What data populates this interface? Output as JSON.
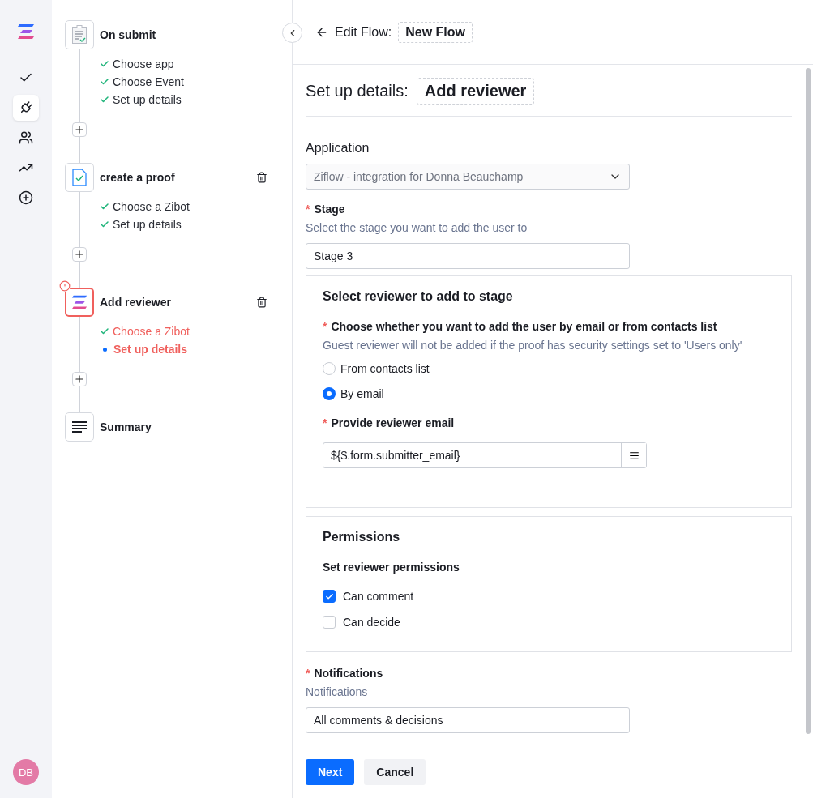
{
  "nav": {
    "items": [
      {
        "kind": "check",
        "selected": false
      },
      {
        "kind": "plug",
        "selected": true
      },
      {
        "kind": "users",
        "selected": false
      },
      {
        "kind": "trend",
        "selected": false
      },
      {
        "kind": "add",
        "selected": false
      }
    ],
    "avatar": "DB"
  },
  "steps": [
    {
      "kind": "form",
      "title": "On submit",
      "error": false,
      "deletable": false,
      "substeps": [
        {
          "label": "Choose app",
          "done": true
        },
        {
          "label": "Choose Event",
          "done": true
        },
        {
          "label": "Set up details",
          "done": true
        }
      ]
    },
    {
      "kind": "proof",
      "title": "create a proof",
      "error": false,
      "deletable": true,
      "substeps": [
        {
          "label": "Choose a Zibot",
          "done": true
        },
        {
          "label": "Set up details",
          "done": true
        }
      ]
    },
    {
      "kind": "zibot",
      "title": "Add reviewer",
      "error": true,
      "deletable": true,
      "substeps": [
        {
          "label": "Choose a Zibot",
          "done": true
        },
        {
          "label": "Set up details",
          "done": false
        }
      ]
    },
    {
      "kind": "summary",
      "title": "Summary",
      "error": false,
      "deletable": false
    }
  ],
  "header": {
    "label": "Edit Flow:",
    "name": "New Flow"
  },
  "section_title": {
    "label": "Set up details:",
    "name": "Add reviewer"
  },
  "application": {
    "label": "Application",
    "value": "Ziflow - integration for Donna Beauchamp",
    "disabled": true
  },
  "stage": {
    "label": "Stage",
    "required_mark": "*",
    "hint": "Select the stage you want to add the user to",
    "value": "Stage 3"
  },
  "reviewer_card": {
    "title": "Select reviewer to add to stage",
    "question": {
      "label": "Choose whether you want to add the user by email or from contacts list",
      "required_mark": "*",
      "hint": "Guest reviewer will not be added if the proof has security settings set to 'Users only'"
    },
    "options": [
      {
        "label": "From contacts list",
        "selected": false
      },
      {
        "label": "By email",
        "selected": true
      }
    ],
    "email": {
      "label": "Provide reviewer email",
      "required_mark": "*",
      "value": "${$.form.submitter_email}"
    }
  },
  "permissions_card": {
    "title": "Permissions",
    "subtitle": "Set reviewer permissions",
    "options": [
      {
        "label": "Can comment",
        "checked": true
      },
      {
        "label": "Can decide",
        "checked": false
      }
    ]
  },
  "notifications": {
    "label": "Notifications",
    "required_mark": "*",
    "hint": "Notifications",
    "value": "All comments & decisions"
  },
  "buttons": [
    {
      "label": "Next",
      "kind": "primary"
    },
    {
      "label": "Cancel",
      "kind": "secondary"
    }
  ]
}
